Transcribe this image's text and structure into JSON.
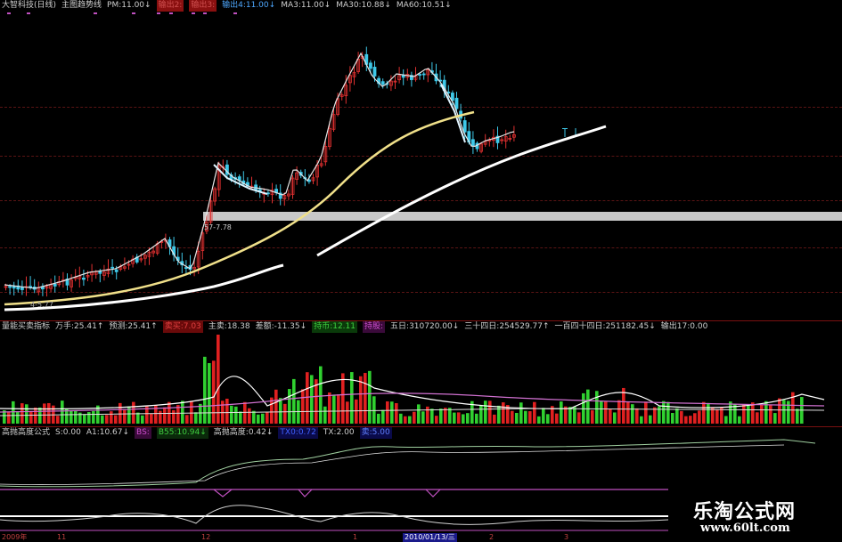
{
  "main_legend": [
    {
      "text": "大智科技(日线)",
      "color": "#cfcfcf"
    },
    {
      "text": "主图趋势线",
      "color": "#cfcfcf"
    },
    {
      "text": "PM:11.00↓",
      "color": "#cfcfcf"
    },
    {
      "text": "输出2:",
      "color": "#d05050",
      "box": "#8a1010"
    },
    {
      "text": "输出3:",
      "color": "#d05050",
      "box": "#8a1010"
    },
    {
      "text": "输出4:11.00↓",
      "color": "#4ea8ff"
    },
    {
      "text": "MA3:11.00↓",
      "color": "#cfcfcf"
    },
    {
      "text": "MA30:10.88↓",
      "color": "#cfcfcf"
    },
    {
      "text": "MA60:10.51↓",
      "color": "#cfcfcf"
    }
  ],
  "main_price_label": "57-7.78",
  "main_low_label": "4-5.77",
  "volume_legend": [
    {
      "text": "量能买卖指标",
      "color": "#cfcfcf"
    },
    {
      "text": "万手:25.41↑",
      "color": "#cfcfcf"
    },
    {
      "text": "预测:25.41↑",
      "color": "#cfcfcf"
    },
    {
      "text": "卖买:7.03",
      "color": "#e04040",
      "box": "#6a0a0a"
    },
    {
      "text": "主卖:18.38",
      "color": "#cfcfcf"
    },
    {
      "text": "差额:-11.35↓",
      "color": "#cfcfcf"
    },
    {
      "text": "持币:12.11",
      "color": "#40d040",
      "box": "#0a3a0a"
    },
    {
      "text": "持股:",
      "color": "#d050d0",
      "box": "#3a0a3a"
    },
    {
      "text": "五日:310720.00↓",
      "color": "#cfcfcf"
    },
    {
      "text": "三十四日:254529.77↑",
      "color": "#cfcfcf"
    },
    {
      "text": "一百四十四日:251182.45↓",
      "color": "#cfcfcf"
    },
    {
      "text": "输出17:0.00",
      "color": "#cfcfcf"
    }
  ],
  "osc_legend": [
    {
      "text": "高抛高度公式",
      "color": "#cfcfcf"
    },
    {
      "text": "S:0.00",
      "color": "#cfcfcf"
    },
    {
      "text": "A1:10.67↓",
      "color": "#cfcfcf"
    },
    {
      "text": "BS:",
      "color": "#d050d0",
      "box": "#3a0a3a"
    },
    {
      "text": "B55:10.94↓",
      "color": "#40d040",
      "box": "#0a2a0a"
    },
    {
      "text": "高抛高度:0.42↓",
      "color": "#cfcfcf"
    },
    {
      "text": "TX0:0.72",
      "color": "#4060ff",
      "box": "#0a0a4a"
    },
    {
      "text": "TX:2.00",
      "color": "#cfcfcf"
    },
    {
      "text": "卖:5.00",
      "color": "#6080ff",
      "box": "#0a0a4a"
    }
  ],
  "time_axis": [
    {
      "text": "2009年",
      "color": "#c04040"
    },
    {
      "text": "11",
      "color": "#c04040"
    },
    {
      "text": "12",
      "color": "#c04040"
    },
    {
      "text": "1",
      "color": "#c04040"
    },
    {
      "text": "2010/01/13/三",
      "color": "#ffffff",
      "box": "#1a1a8a"
    },
    {
      "text": "2",
      "color": "#c04040"
    },
    {
      "text": "3",
      "color": "#c04040"
    }
  ],
  "watermark": {
    "title": "乐淘公式网",
    "url": "www.60lt.com"
  }
}
